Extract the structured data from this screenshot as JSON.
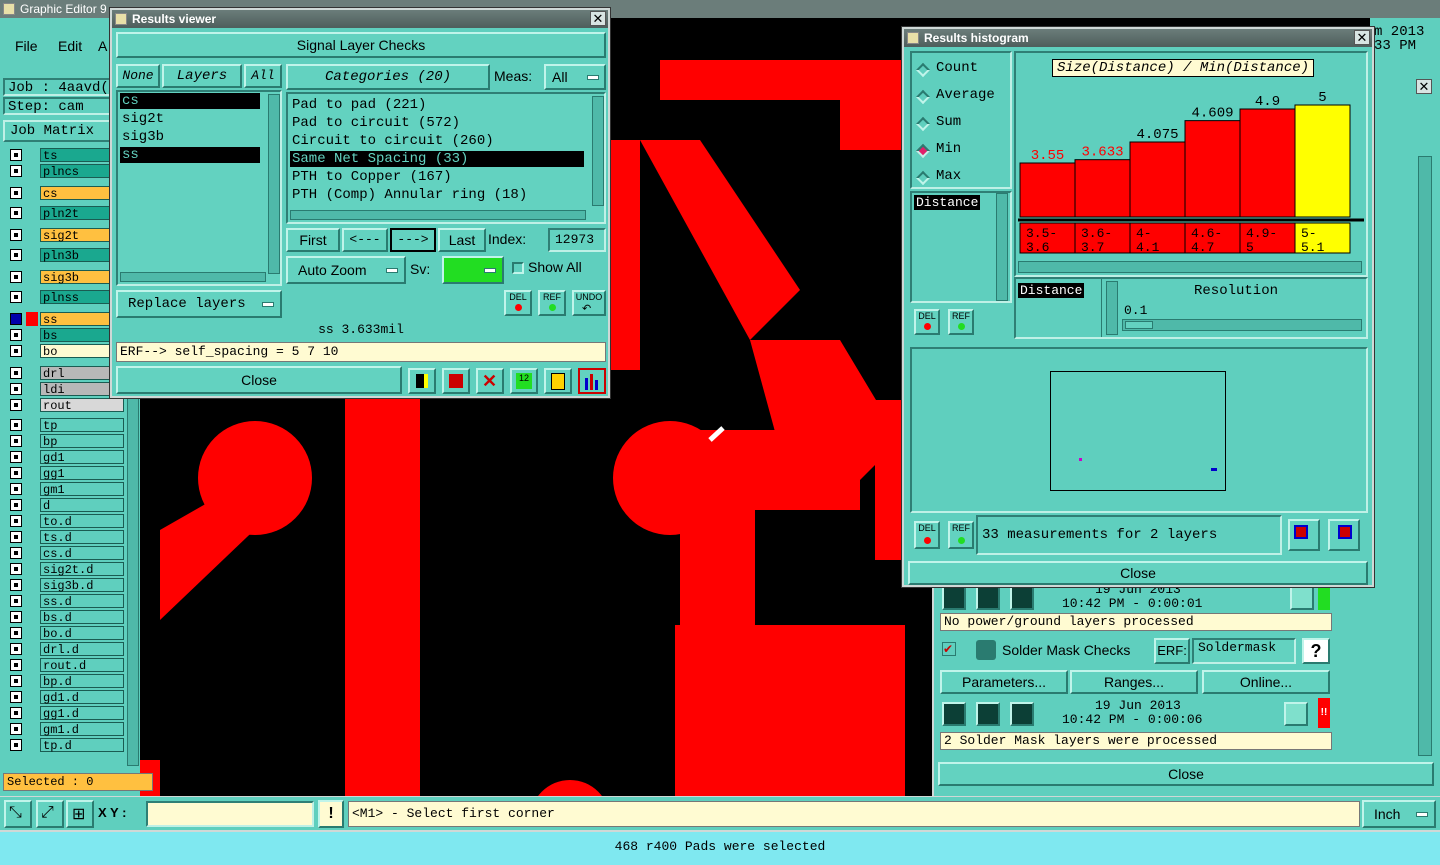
{
  "app": {
    "title": "Graphic Editor 9",
    "menu": [
      "File",
      "Edit",
      "A"
    ]
  },
  "left": {
    "job": "Job : 4aavd(",
    "step": "Step: cam",
    "job_matrix": "Job Matrix",
    "selected": "Selected : 0",
    "layers": [
      {
        "n": "ts",
        "c": "#1aa88f"
      },
      {
        "n": "plncs",
        "c": "#1aa88f"
      },
      {
        "n": "cs",
        "c": "#ffc040"
      },
      {
        "n": "pln2t",
        "c": "#1aa88f"
      },
      {
        "n": "sig2t",
        "c": "#ffc040"
      },
      {
        "n": "pln3b",
        "c": "#1aa88f"
      },
      {
        "n": "sig3b",
        "c": "#ffc040"
      },
      {
        "n": "plnss",
        "c": "#1aa88f"
      },
      {
        "n": "ss",
        "c": "#ffc040"
      },
      {
        "n": "bs",
        "c": "#1aa88f"
      },
      {
        "n": "bo",
        "c": "#fffbd2"
      },
      {
        "n": "drl",
        "c": "#b8b8b8"
      },
      {
        "n": "ldi",
        "c": "#b8b8b8"
      },
      {
        "n": "rout",
        "c": "#d8d8d8"
      },
      {
        "n": "tp",
        "c": "#5fcfbe"
      },
      {
        "n": "bp",
        "c": "#5fcfbe"
      },
      {
        "n": "gd1",
        "c": "#5fcfbe"
      },
      {
        "n": "gg1",
        "c": "#5fcfbe"
      },
      {
        "n": "gm1",
        "c": "#5fcfbe"
      },
      {
        "n": "d",
        "c": "#5fcfbe"
      },
      {
        "n": "to.d",
        "c": "#5fcfbe"
      },
      {
        "n": "ts.d",
        "c": "#5fcfbe"
      },
      {
        "n": "cs.d",
        "c": "#5fcfbe"
      },
      {
        "n": "sig2t.d",
        "c": "#5fcfbe"
      },
      {
        "n": "sig3b.d",
        "c": "#5fcfbe"
      },
      {
        "n": "ss.d",
        "c": "#5fcfbe"
      },
      {
        "n": "bs.d",
        "c": "#5fcfbe"
      },
      {
        "n": "bo.d",
        "c": "#5fcfbe"
      },
      {
        "n": "drl.d",
        "c": "#5fcfbe"
      },
      {
        "n": "rout.d",
        "c": "#5fcfbe"
      },
      {
        "n": "bp.d",
        "c": "#5fcfbe"
      },
      {
        "n": "gd1.d",
        "c": "#5fcfbe"
      },
      {
        "n": "gg1.d",
        "c": "#5fcfbe"
      },
      {
        "n": "gm1.d",
        "c": "#5fcfbe"
      },
      {
        "n": "tp.d",
        "c": "#5fcfbe"
      }
    ]
  },
  "rv": {
    "title": "Results viewer",
    "header": "Signal Layer Checks",
    "none": "None",
    "layers": "Layers",
    "all": "All",
    "layer_list": [
      "cs",
      "sig2t",
      "sig3b",
      "ss"
    ],
    "categories": "Categories (20)",
    "meas": "Meas:",
    "meas_val": "All",
    "cat_list": [
      "Pad to pad (221)",
      "Pad to circuit (572)",
      "Circuit to circuit (260)",
      "Same Net Spacing (33)",
      "PTH to Copper (167)",
      "PTH (Comp) Annular ring (18)"
    ],
    "first": "First",
    "prev": "<---",
    "next": "--->",
    "last": "Last",
    "index_label": "Index:",
    "index_val": "12973",
    "auto_zoom": "Auto Zoom",
    "sv": "Sv:",
    "show_all": "Show All",
    "replace": "Replace layers",
    "del": "DEL",
    "ref": "REF",
    "undo": "UNDO",
    "status": "ss 3.633mil",
    "erf": "ERF--> self_spacing = 5 7 10",
    "close": "Close"
  },
  "hist": {
    "title": "Results histogram",
    "options": [
      "Count",
      "Average",
      "Sum",
      "Min",
      "Max"
    ],
    "selected": "Min",
    "distance": "Distance",
    "chart_title": "Size(Distance) / Min(Distance)",
    "resolution": "Resolution",
    "res_val": "0.1",
    "summary": "33 measurements for 2 layers",
    "close": "Close",
    "del": "DEL",
    "ref": "REF"
  },
  "chart_data": {
    "type": "bar",
    "title": "Size(Distance) / Min(Distance)",
    "categories": [
      "3.5-3.6",
      "3.6-3.7",
      "4-4.1",
      "4.6-4.7",
      "4.9-5",
      "5-5.1"
    ],
    "cat_parts": [
      [
        "3.5-",
        "3.6"
      ],
      [
        "3.6-",
        "3.7"
      ],
      [
        "4-",
        "4.1"
      ],
      [
        "4.6-",
        "4.7"
      ],
      [
        "4.9-",
        "5"
      ],
      [
        "5-",
        "5.1"
      ]
    ],
    "values": [
      3.55,
      3.633,
      4.075,
      4.609,
      4.9,
      5
    ],
    "labels": [
      "3.55",
      "3.633",
      "4.075",
      "4.609",
      "4.9",
      "5"
    ],
    "colors": [
      "#ff0000",
      "#ff0000",
      "#ff0000",
      "#ff0000",
      "#ff0000",
      "#ffff00"
    ],
    "label_colors": [
      "#ff0000",
      "#ff0000",
      "#000000",
      "#000000",
      "#000000",
      "#000000"
    ],
    "ylim": [
      0,
      5
    ]
  },
  "rp": {
    "date1": "19 Jun 2013",
    "time1": "10:42 PM - 0:00:01",
    "msg1": "No power/ground layers processed",
    "smc": "Solder Mask Checks",
    "erf": "ERF:",
    "soldermask": "Soldermask",
    "q": "?",
    "params": "Parameters...",
    "ranges": "Ranges...",
    "online": "Online...",
    "date2": "19 Jun 2013",
    "time2": "10:42 PM - 0:00:06",
    "msg2": "2 Solder Mask layers were processed",
    "close": "Close",
    "bang": "!!",
    "top_date": "m 2013",
    "top_time": "33 PM"
  },
  "bottom": {
    "xy": "X Y :",
    "excl": "!",
    "prompt": "<M1> - Select first corner",
    "unit": "Inch",
    "status": "468 r400 Pads were selected"
  }
}
